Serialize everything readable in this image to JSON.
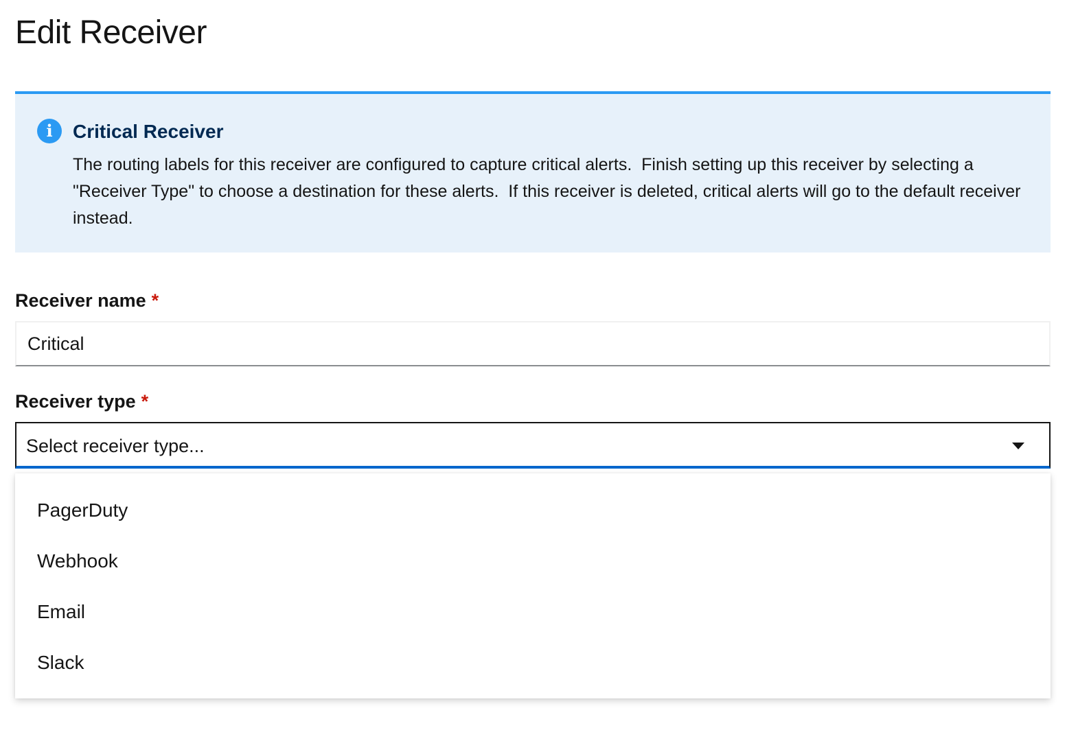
{
  "page": {
    "title": "Edit Receiver"
  },
  "alert": {
    "icon": "info-circle-icon",
    "title": "Critical Receiver",
    "body": "The routing labels for this receiver are configured to capture critical alerts.  Finish setting up this receiver by selecting a \"Receiver Type\" to choose a destination for these alerts.  If this receiver is deleted, critical alerts will go to the default receiver instead.",
    "accent_color": "#2b9af3",
    "background_color": "#e7f1fa"
  },
  "form": {
    "receiver_name": {
      "label": "Receiver name",
      "required_marker": "*",
      "value": "Critical"
    },
    "receiver_type": {
      "label": "Receiver type",
      "required_marker": "*",
      "placeholder": "Select receiver type...",
      "expanded": true,
      "options": [
        "PagerDuty",
        "Webhook",
        "Email",
        "Slack"
      ]
    }
  },
  "colors": {
    "required": "#c9190b",
    "focus_underline": "#0066cc",
    "text": "#151515"
  }
}
